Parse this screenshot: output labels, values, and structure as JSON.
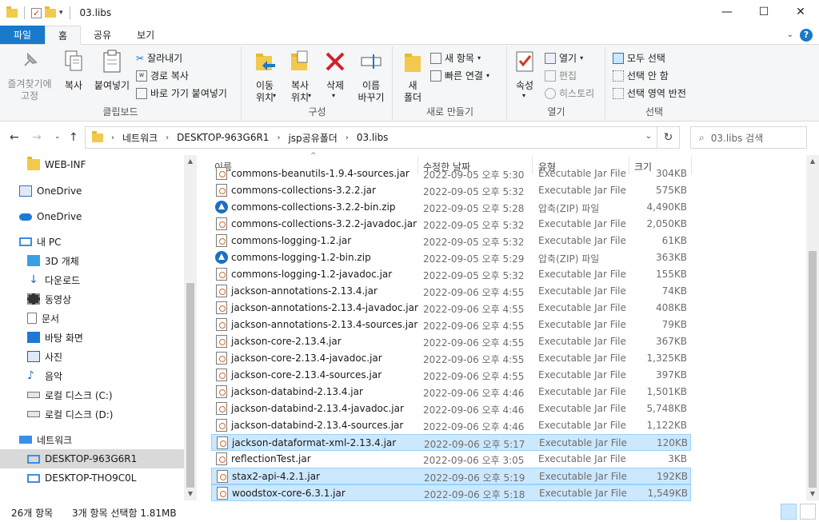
{
  "window": {
    "title": "03.libs",
    "minimize": "—",
    "maximize": "☐",
    "close": "✕"
  },
  "ribbon_tabs": {
    "file": "파일",
    "home": "홈",
    "share": "공유",
    "view": "보기"
  },
  "ribbon": {
    "clipboard": {
      "label": "클립보드",
      "pin": "즐겨찾기에\n고정",
      "copy": "복사",
      "paste": "붙여넣기",
      "cut": "잘라내기",
      "copy_path": "경로 복사",
      "paste_shortcut": "바로 가기 붙여넣기"
    },
    "organize": {
      "label": "구성",
      "move_to": "이동\n위치",
      "copy_to": "복사\n위치",
      "delete": "삭제",
      "rename": "이름\n바꾸기"
    },
    "new": {
      "label": "새로 만들기",
      "new_folder": "새\n폴더",
      "new_item": "새 항목",
      "easy_access": "빠른 연결"
    },
    "open": {
      "label": "열기",
      "properties": "속성",
      "open": "열기",
      "edit": "편집",
      "history": "히스토리"
    },
    "select": {
      "label": "선택",
      "select_all": "모두 선택",
      "select_none": "선택 안 함",
      "invert": "선택 영역 반전"
    }
  },
  "address": {
    "crumbs": [
      "네트워크",
      "DESKTOP-963G6R1",
      "jsp공유폴더",
      "03.libs"
    ],
    "search_placeholder": "03.libs 검색"
  },
  "nav": {
    "items": [
      {
        "label": "WEB-INF",
        "icon": "folder-icon"
      },
      {
        "label": "OneDrive",
        "icon": "onedrive-icon"
      },
      {
        "label": "OneDrive",
        "icon": "cloud-icon"
      },
      {
        "label": "내 PC",
        "icon": "pc-icon"
      },
      {
        "label": "3D 개체",
        "icon": "3d-objects-icon"
      },
      {
        "label": "다운로드",
        "icon": "download-icon"
      },
      {
        "label": "동영상",
        "icon": "video-icon"
      },
      {
        "label": "문서",
        "icon": "document-icon"
      },
      {
        "label": "바탕 화면",
        "icon": "desktop-icon"
      },
      {
        "label": "사진",
        "icon": "picture-icon"
      },
      {
        "label": "음악",
        "icon": "music-icon"
      },
      {
        "label": "로컬 디스크 (C:)",
        "icon": "disk-icon"
      },
      {
        "label": "로컬 디스크 (D:)",
        "icon": "disk-icon"
      },
      {
        "label": "네트워크",
        "icon": "network-icon"
      },
      {
        "label": "DESKTOP-963G6R1",
        "icon": "computer-icon"
      },
      {
        "label": "DESKTOP-THO9C0L",
        "icon": "computer-icon"
      }
    ]
  },
  "columns": {
    "name": "이름",
    "date": "수정한 날짜",
    "type": "유형",
    "size": "크기"
  },
  "files": [
    {
      "name": "commons-beanutils-1.9.4-sources.jar",
      "date": "2022-09-05 오후 5:30",
      "type": "Executable Jar File",
      "size": "304KB",
      "icon": "jar",
      "selected": false
    },
    {
      "name": "commons-collections-3.2.2.jar",
      "date": "2022-09-05 오후 5:32",
      "type": "Executable Jar File",
      "size": "575KB",
      "icon": "jar",
      "selected": false
    },
    {
      "name": "commons-collections-3.2.2-bin.zip",
      "date": "2022-09-05 오후 5:28",
      "type": "압축(ZIP) 파일",
      "size": "4,490KB",
      "icon": "zip",
      "selected": false
    },
    {
      "name": "commons-collections-3.2.2-javadoc.jar",
      "date": "2022-09-05 오후 5:32",
      "type": "Executable Jar File",
      "size": "2,050KB",
      "icon": "jar",
      "selected": false
    },
    {
      "name": "commons-logging-1.2.jar",
      "date": "2022-09-05 오후 5:32",
      "type": "Executable Jar File",
      "size": "61KB",
      "icon": "jar",
      "selected": false
    },
    {
      "name": "commons-logging-1.2-bin.zip",
      "date": "2022-09-05 오후 5:29",
      "type": "압축(ZIP) 파일",
      "size": "363KB",
      "icon": "zip",
      "selected": false
    },
    {
      "name": "commons-logging-1.2-javadoc.jar",
      "date": "2022-09-05 오후 5:32",
      "type": "Executable Jar File",
      "size": "155KB",
      "icon": "jar",
      "selected": false
    },
    {
      "name": "jackson-annotations-2.13.4.jar",
      "date": "2022-09-06 오후 4:55",
      "type": "Executable Jar File",
      "size": "74KB",
      "icon": "jar",
      "selected": false
    },
    {
      "name": "jackson-annotations-2.13.4-javadoc.jar",
      "date": "2022-09-06 오후 4:55",
      "type": "Executable Jar File",
      "size": "408KB",
      "icon": "jar",
      "selected": false
    },
    {
      "name": "jackson-annotations-2.13.4-sources.jar",
      "date": "2022-09-06 오후 4:55",
      "type": "Executable Jar File",
      "size": "79KB",
      "icon": "jar",
      "selected": false
    },
    {
      "name": "jackson-core-2.13.4.jar",
      "date": "2022-09-06 오후 4:55",
      "type": "Executable Jar File",
      "size": "367KB",
      "icon": "jar",
      "selected": false
    },
    {
      "name": "jackson-core-2.13.4-javadoc.jar",
      "date": "2022-09-06 오후 4:55",
      "type": "Executable Jar File",
      "size": "1,325KB",
      "icon": "jar",
      "selected": false
    },
    {
      "name": "jackson-core-2.13.4-sources.jar",
      "date": "2022-09-06 오후 4:55",
      "type": "Executable Jar File",
      "size": "397KB",
      "icon": "jar",
      "selected": false
    },
    {
      "name": "jackson-databind-2.13.4.jar",
      "date": "2022-09-06 오후 4:46",
      "type": "Executable Jar File",
      "size": "1,501KB",
      "icon": "jar",
      "selected": false
    },
    {
      "name": "jackson-databind-2.13.4-javadoc.jar",
      "date": "2022-09-06 오후 4:46",
      "type": "Executable Jar File",
      "size": "5,748KB",
      "icon": "jar",
      "selected": false
    },
    {
      "name": "jackson-databind-2.13.4-sources.jar",
      "date": "2022-09-06 오후 4:46",
      "type": "Executable Jar File",
      "size": "1,122KB",
      "icon": "jar",
      "selected": false
    },
    {
      "name": "jackson-dataformat-xml-2.13.4.jar",
      "date": "2022-09-06 오후 5:17",
      "type": "Executable Jar File",
      "size": "120KB",
      "icon": "jar",
      "selected": true
    },
    {
      "name": "reflectionTest.jar",
      "date": "2022-09-06 오후 3:05",
      "type": "Executable Jar File",
      "size": "3KB",
      "icon": "jar",
      "selected": false
    },
    {
      "name": "stax2-api-4.2.1.jar",
      "date": "2022-09-06 오후 5:19",
      "type": "Executable Jar File",
      "size": "192KB",
      "icon": "jar",
      "selected": true
    },
    {
      "name": "woodstox-core-6.3.1.jar",
      "date": "2022-09-06 오후 5:18",
      "type": "Executable Jar File",
      "size": "1,549KB",
      "icon": "jar",
      "selected": true
    }
  ],
  "status": {
    "count": "26개 항목",
    "selection": "3개 항목 선택함 1.81MB"
  },
  "colors": {
    "accent": "#1979ca",
    "selection": "#cce8ff",
    "selection_border": "#99d1ff"
  }
}
